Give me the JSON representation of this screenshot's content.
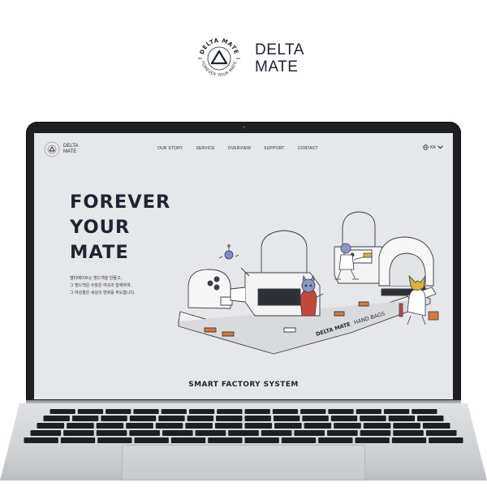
{
  "brand": {
    "name_line1": "DELTA",
    "name_line2": "MATE",
    "ring_top": "DELTA MATE",
    "ring_bottom": "FOREVER YOUR MATE"
  },
  "website": {
    "logo_line1": "DELTA",
    "logo_line2": "MATE",
    "nav": [
      "OUR STORY",
      "SERVICE",
      "OVERVIEW",
      "SUPPORT",
      "CONTACT"
    ],
    "language": "KR",
    "hero": {
      "title_line1": "FOREVER",
      "title_line2": "YOUR",
      "title_line3": "MATE",
      "desc_line1": "델타메이트는 핸드백을 만들고,",
      "desc_line2": "그 핸드백은 수많은 여성과 함께하며,",
      "desc_line3": "그 여성들은 세상의 변화를 주도합니다."
    },
    "illustration_label_bold": "DELTA MATE",
    "illustration_label_light": "HAND BAGS",
    "section_title": "SMART FACTORY SYSTEM"
  },
  "colors": {
    "navy": "#1f2433",
    "screen_bg": "#e6e7e9",
    "accent_orange": "#d8783a",
    "accent_red": "#c24a3a"
  },
  "icons": [
    "delta-mate-emblem",
    "globe-icon",
    "chevron-down-icon"
  ]
}
